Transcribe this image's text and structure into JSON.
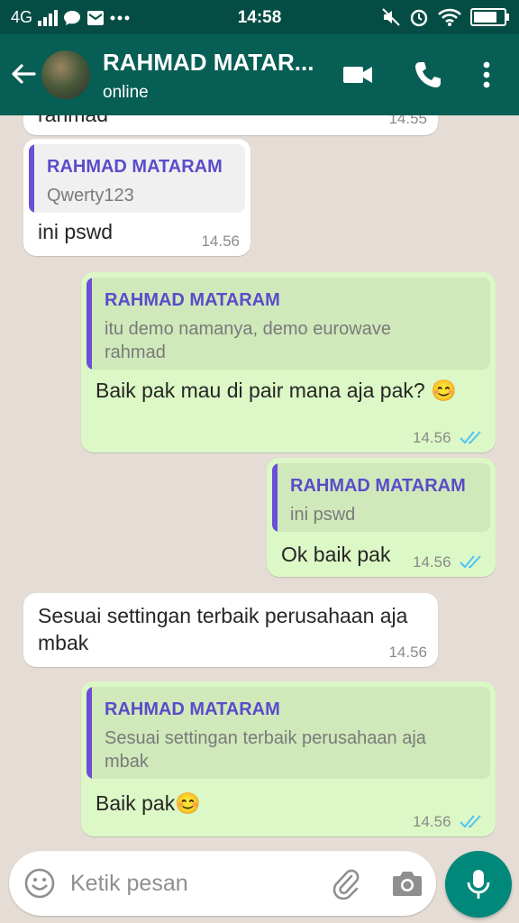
{
  "status_bar": {
    "network": "4G",
    "time": "14:58",
    "battery_level": 0.9
  },
  "header": {
    "contact_name": "RAHMAD MATAR...",
    "status": "online"
  },
  "messages": [
    {
      "direction": "in",
      "body": "rahmad",
      "time": "14.55"
    },
    {
      "direction": "in",
      "quote_author": "RAHMAD MATARAM",
      "quote_text": "Qwerty123",
      "body": "ini pswd",
      "time": "14.56"
    },
    {
      "direction": "out",
      "quote_author": "RAHMAD MATARAM",
      "quote_text": "itu demo namanya, demo eurowave rahmad",
      "body": "Baik pak mau di pair mana aja pak? 😊",
      "time": "14.56",
      "read": true
    },
    {
      "direction": "out",
      "quote_author": "RAHMAD MATARAM",
      "quote_text": "ini pswd",
      "body": "Ok baik pak",
      "time": "14.56",
      "read": true
    },
    {
      "direction": "in",
      "body": "Sesuai settingan terbaik perusahaan aja mbak",
      "time": "14.56"
    },
    {
      "direction": "out",
      "quote_author": "RAHMAD MATARAM",
      "quote_text": "Sesuai settingan terbaik perusahaan aja mbak",
      "body": "Baik pak😊",
      "time": "14.56",
      "read": true
    }
  ],
  "composer": {
    "placeholder": "Ketik pesan"
  },
  "colors": {
    "status_bar": "#054d44",
    "app_bar": "#075e54",
    "chat_background": "#e5ddd5",
    "outgoing_bubble": "#dcf8c6",
    "incoming_bubble": "#ffffff",
    "quote_accent": "#6b4fd8",
    "read_ticks": "#4fc3f7",
    "mic_button": "#00897b"
  },
  "icons": {
    "back": "arrow-left-icon",
    "video": "video-camera-icon",
    "call": "phone-icon",
    "menu": "more-vertical-icon",
    "emoji": "emoji-icon",
    "attach": "paperclip-icon",
    "camera": "camera-icon",
    "mic": "microphone-icon"
  }
}
